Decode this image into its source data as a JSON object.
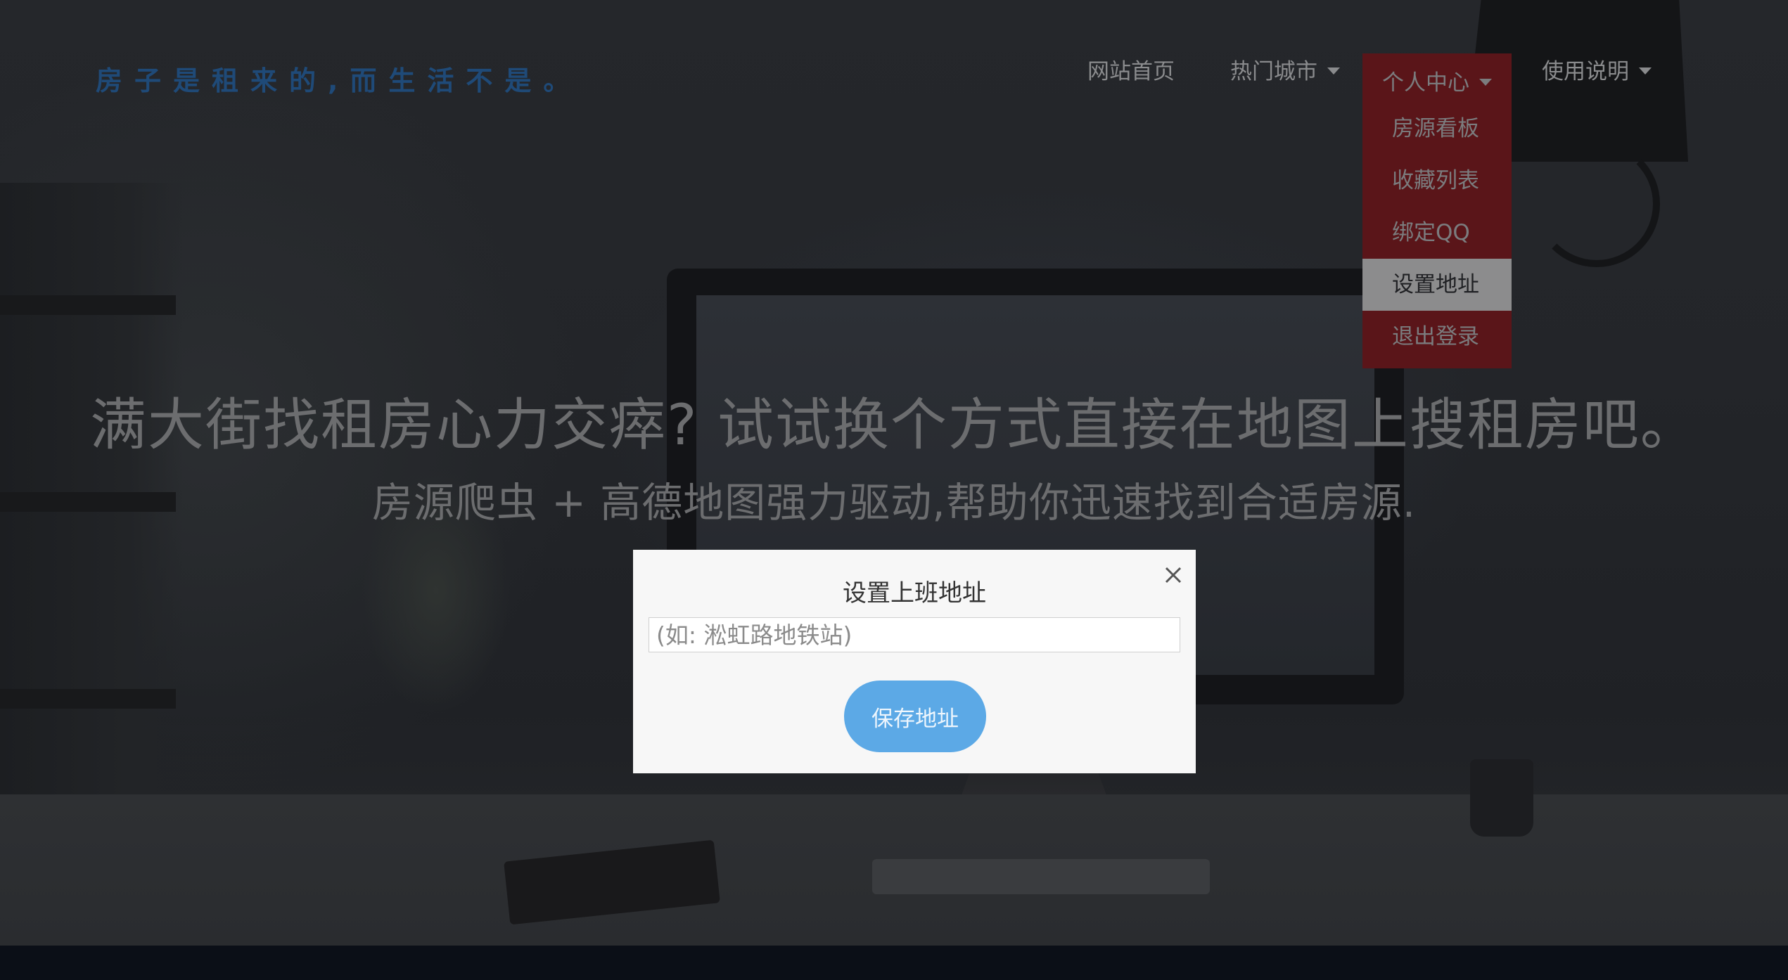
{
  "brand": {
    "text": "房子是租来的,而生活不是。"
  },
  "nav": {
    "items": [
      {
        "label": "网站首页"
      },
      {
        "label": "热门城市"
      },
      {
        "label": "个人中心"
      },
      {
        "label": "使用说明"
      }
    ],
    "dropdown": {
      "items": [
        {
          "label": "房源看板"
        },
        {
          "label": "收藏列表"
        },
        {
          "label": "绑定QQ"
        },
        {
          "label": "设置地址"
        },
        {
          "label": "退出登录"
        }
      ],
      "selected": "设置地址"
    }
  },
  "hero": {
    "headline": "满大街找租房心力交瘁? 试试换个方式直接在地图上搜租房吧。",
    "subheadline": "房源爬虫 + 高德地图强力驱动,帮助你迅速找到合适房源."
  },
  "modal": {
    "title": "设置上班地址",
    "input_placeholder": "(如: 淞虹路地铁站)",
    "input_value": "",
    "save_label": "保存地址",
    "close_icon": "close-icon"
  },
  "colors": {
    "brand": "#1f4a78",
    "dropdown_bg": "#5a1519",
    "dropdown_selected_bg": "#8c8c8d",
    "save_button": "#5ca9e6",
    "modal_bg": "#f7f7f7"
  }
}
